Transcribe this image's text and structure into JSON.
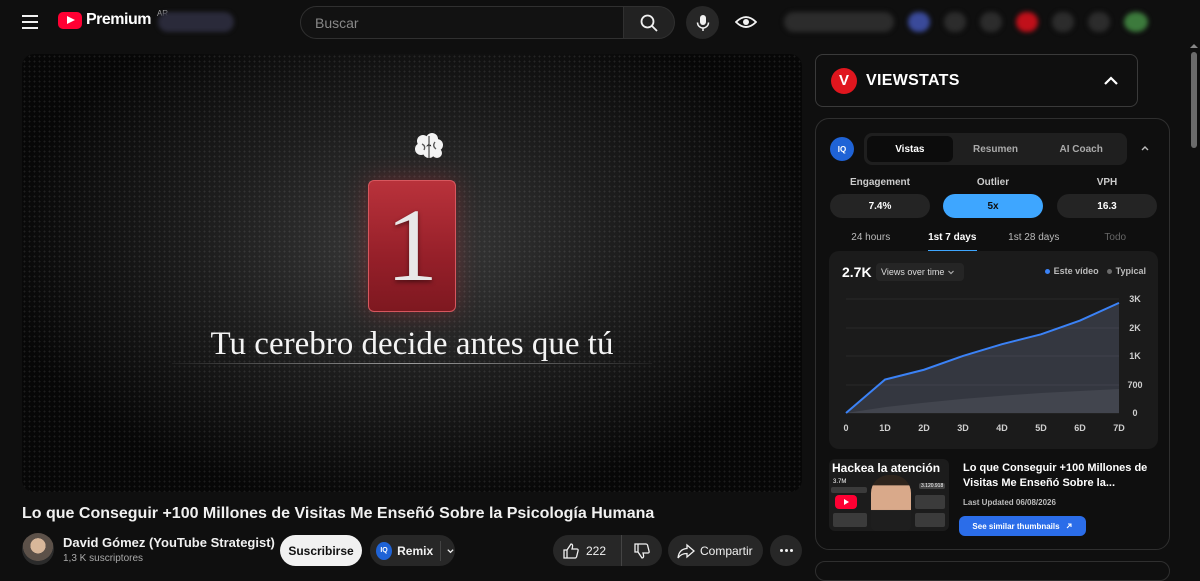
{
  "header": {
    "logo_text": "Premium",
    "logo_country": "AR",
    "search": {
      "placeholder": "Buscar"
    },
    "icons": [
      "menu-icon",
      "search-icon",
      "mic-icon",
      "eye-icon"
    ]
  },
  "video": {
    "overlay_number": "1",
    "overlay_caption": "Tu cerebro decide antes que tú",
    "title": "Lo que Conseguir +100 Millones de Visitas Me Enseñó Sobre la Psicología Humana",
    "channel_name": "David Gómez (YouTube Strategist)",
    "subscribers": "1,3 K suscriptores",
    "subscribe_label": "Suscribirse",
    "remix_label": "Remix",
    "remix_badge": "IQ",
    "like_count": "222",
    "share_label": "Compartir"
  },
  "viewstats": {
    "logo_letter": "V",
    "title": "VIEWSTATS",
    "iq_badge": "IQ",
    "tabs": [
      {
        "label": "Vistas",
        "active": true
      },
      {
        "label": "Resumen",
        "active": false
      },
      {
        "label": "AI Coach",
        "active": false
      }
    ],
    "metrics": [
      {
        "label": "Engagement",
        "value": "7.4%"
      },
      {
        "label": "Outlier",
        "value": "5x"
      },
      {
        "label": "VPH",
        "value": "16.3"
      }
    ],
    "periods": [
      {
        "label": "24 hours",
        "state": "normal"
      },
      {
        "label": "1st 7 days",
        "state": "active"
      },
      {
        "label": "1st 28 days",
        "state": "normal"
      },
      {
        "label": "Todo",
        "state": "dim"
      }
    ],
    "chart_value": "2.7K",
    "chart_selector": "Views over time",
    "recommendation": {
      "thumb_title": "Hackea la atención",
      "thumb_stat": "3.7M",
      "thumb_stat2": "3.120.918",
      "title": "Lo que Conseguir +100 Millones de Visitas Me Enseñó Sobre la...",
      "updated": "Last Updated 06/08/2026",
      "button": "See similar thumbnails"
    }
  },
  "colors": {
    "accent_blue": "#3ea6ff",
    "brand_red": "#ff0033",
    "viewstats_red": "#e0161e",
    "series_este": "#3b82f6",
    "series_typical": "#6b6b6b"
  },
  "chart_data": {
    "type": "area",
    "x": [
      "0",
      "1D",
      "2D",
      "3D",
      "4D",
      "5D",
      "6D",
      "7D"
    ],
    "yticks": [
      "0",
      "700",
      "1K",
      "2K",
      "3K"
    ],
    "ylim": [
      0,
      3000
    ],
    "grid": true,
    "legend_position": "top-right",
    "series": [
      {
        "name": "Este vídeo",
        "values": [
          0,
          850,
          1100,
          1450,
          1750,
          2000,
          2350,
          2800
        ]
      },
      {
        "name": "Typical",
        "values": [
          0,
          150,
          260,
          360,
          440,
          510,
          560,
          610
        ]
      }
    ]
  }
}
